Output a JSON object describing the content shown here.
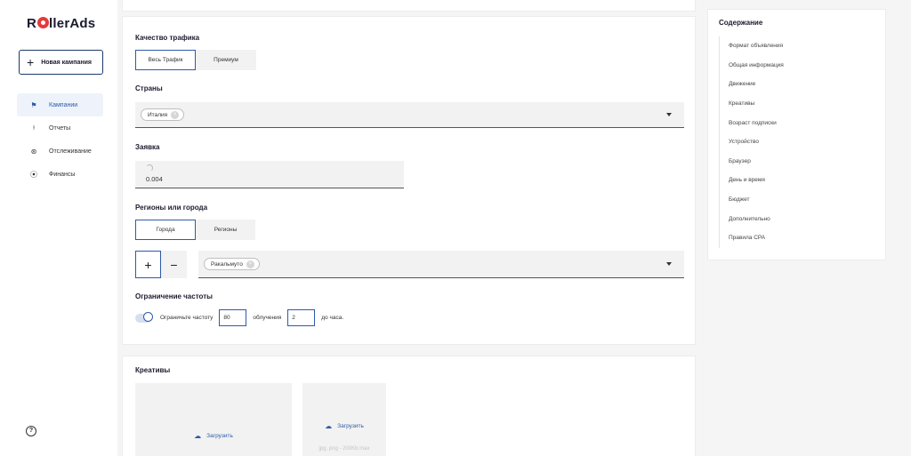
{
  "brand": {
    "logo_prefix": "R",
    "logo_suffix": "llerAds",
    "accent": "#e33b3b",
    "primary": "#2e5aa8"
  },
  "sidebar": {
    "new_campaign": "Новая кампания",
    "items": [
      {
        "label": "Кампании",
        "icon": "flag-icon",
        "active": true
      },
      {
        "label": "Отчеты",
        "icon": "chart-icon"
      },
      {
        "label": "Отслеживание",
        "icon": "tracking-icon"
      },
      {
        "label": "Финансы",
        "icon": "finance-icon"
      }
    ],
    "help": "?"
  },
  "traffic": {
    "title": "Качество трафика",
    "options": [
      "Весь Трафик",
      "Премиум"
    ],
    "selected": 0
  },
  "countries": {
    "title": "Страны",
    "chips": [
      "Италия"
    ]
  },
  "bid": {
    "title": "Заявка",
    "value": "0.004"
  },
  "regions": {
    "title": "Регионы или города",
    "options": [
      "Города",
      "Регионы"
    ],
    "selected": 0,
    "chips": [
      "Ракальмуто"
    ],
    "plus": "+",
    "minus": "−"
  },
  "frequency": {
    "title": "Ограничение частоты",
    "label": "Ограничьте частоту",
    "count": "80",
    "mid": "облучения",
    "hours": "2",
    "suffix": "до часа.",
    "enabled": true
  },
  "creatives": {
    "title": "Креативы",
    "upload1": "Загрузить",
    "upload2": "Загрузить",
    "hint": "jpg, png - 200Kb max"
  },
  "toc": {
    "title": "Содержание",
    "items": [
      "Формат объявления",
      "Общая информация",
      "Движение",
      "Креативы",
      "Возраст подписки",
      "Устройство",
      "Браузер",
      "День и время",
      "Бюджет",
      "Дополнительно",
      "Правила CPA"
    ]
  }
}
